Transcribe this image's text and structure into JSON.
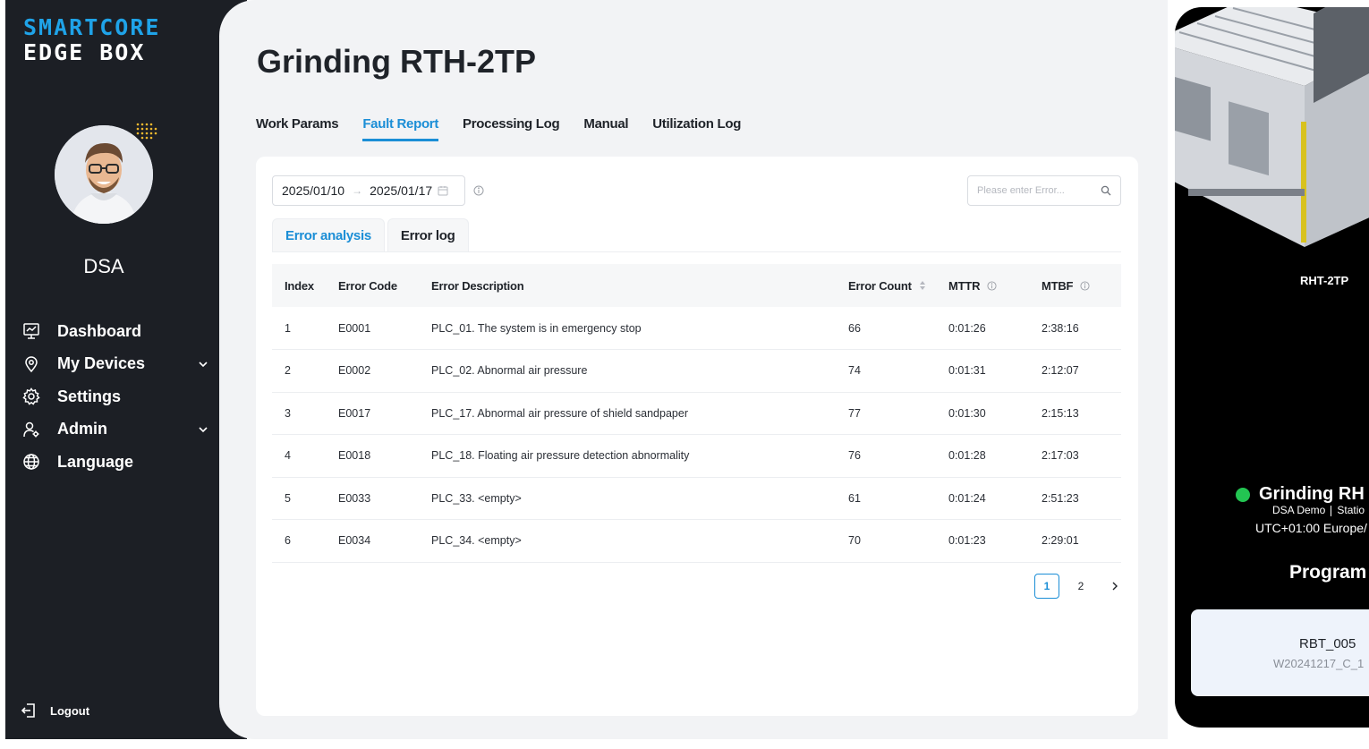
{
  "brand": {
    "line1": "SMARTCORE",
    "line2": "EDGE BOX"
  },
  "user": {
    "name": "DSA"
  },
  "nav": [
    {
      "label": "Dashboard",
      "icon": "dashboard-icon",
      "expandable": false
    },
    {
      "label": "My Devices",
      "icon": "location-pin-icon",
      "expandable": true
    },
    {
      "label": "Settings",
      "icon": "gear-icon",
      "expandable": false
    },
    {
      "label": "Admin",
      "icon": "user-admin-icon",
      "expandable": true
    },
    {
      "label": "Language",
      "icon": "globe-icon",
      "expandable": false
    }
  ],
  "logout": "Logout",
  "page": {
    "title": "Grinding RTH-2TP"
  },
  "tabs": [
    "Work Params",
    "Fault Report",
    "Processing Log",
    "Manual",
    "Utilization Log"
  ],
  "active_tab": "Fault Report",
  "filters": {
    "date_start": "2025/01/10",
    "date_end": "2025/01/17",
    "search_placeholder": "Please enter Error..."
  },
  "subtabs": [
    "Error analysis",
    "Error log"
  ],
  "active_subtab": "Error analysis",
  "table": {
    "columns": [
      "Index",
      "Error Code",
      "Error Description",
      "Error Count",
      "MTTR",
      "MTBF"
    ],
    "rows": [
      [
        "1",
        "E0001",
        "PLC_01. The system is in emergency stop",
        "66",
        "0:01:26",
        "2:38:16"
      ],
      [
        "2",
        "E0002",
        "PLC_02. Abnormal air pressure",
        "74",
        "0:01:31",
        "2:12:07"
      ],
      [
        "3",
        "E0017",
        "PLC_17. Abnormal air pressure of shield sandpaper",
        "77",
        "0:01:30",
        "2:15:13"
      ],
      [
        "4",
        "E0018",
        "PLC_18. Floating air pressure detection abnormality",
        "76",
        "0:01:28",
        "2:17:03"
      ],
      [
        "5",
        "E0033",
        "PLC_33. <empty>",
        "61",
        "0:01:24",
        "2:51:23"
      ],
      [
        "6",
        "E0034",
        "PLC_34. <empty>",
        "70",
        "0:01:23",
        "2:29:01"
      ]
    ]
  },
  "pagination": {
    "pages": [
      "1",
      "2"
    ],
    "current": "1",
    "next_icon": "chevron-right-icon"
  },
  "device": {
    "model": "RHT-2TP",
    "name": "Grinding RH",
    "org": "DSA Demo",
    "station": "Statio",
    "timezone": "UTC+01:00 Europe/",
    "program_heading": "Program",
    "program_name": "RBT_005",
    "program_id": "W20241217_C_1",
    "status_color": "#23c552"
  },
  "colors": {
    "accent": "#1b8ed6",
    "sidebar_bg": "#1c1f25",
    "brand_blue": "#1fa3e8"
  }
}
